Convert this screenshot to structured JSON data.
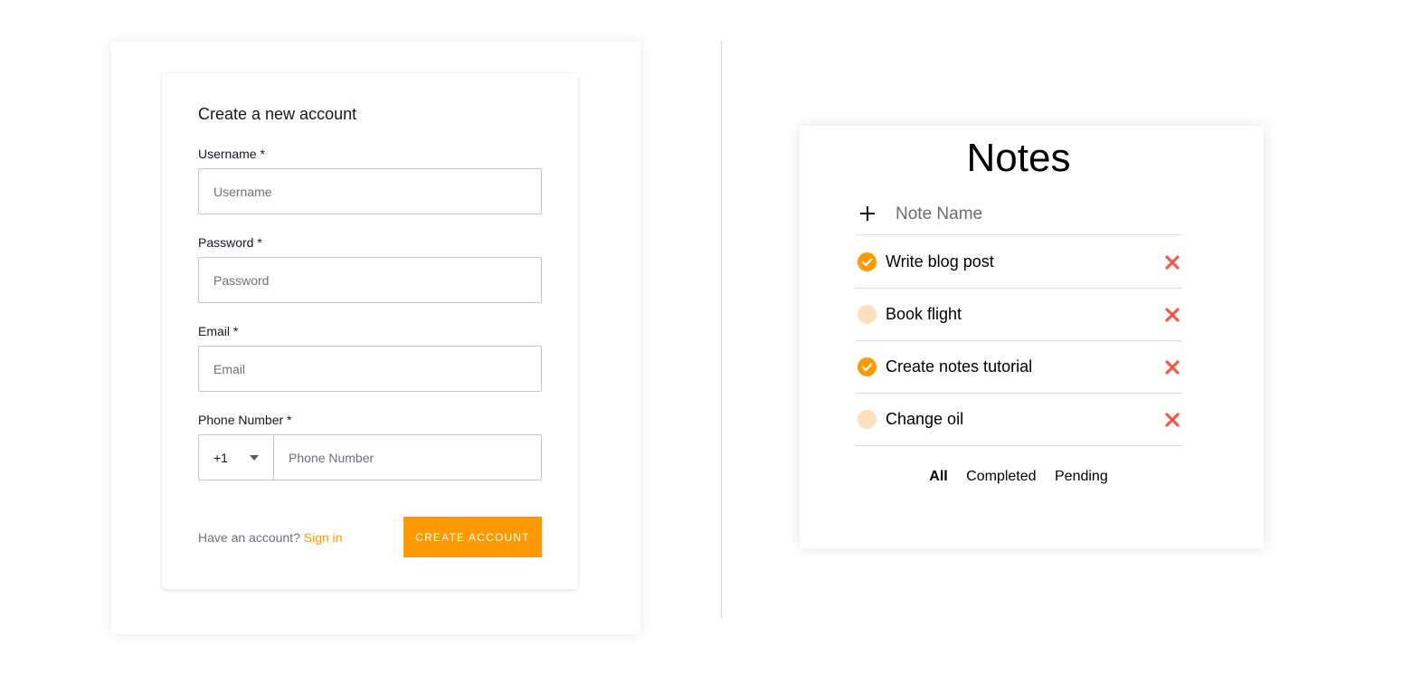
{
  "signup": {
    "title": "Create a new account",
    "username_label": "Username *",
    "username_placeholder": "Username",
    "password_label": "Password *",
    "password_placeholder": "Password",
    "email_label": "Email *",
    "email_placeholder": "Email",
    "phone_label": "Phone Number *",
    "dial_code": "+1",
    "phone_placeholder": "Phone Number",
    "have_account_text": "Have an account?",
    "signin_link": "Sign in",
    "create_button": "CREATE ACCOUNT"
  },
  "notes": {
    "title": "Notes",
    "add_placeholder": "Note Name",
    "items": [
      {
        "text": "Write blog post",
        "completed": true
      },
      {
        "text": "Book flight",
        "completed": false
      },
      {
        "text": "Create notes tutorial",
        "completed": true
      },
      {
        "text": "Change oil",
        "completed": false
      }
    ],
    "filters": {
      "all": "All",
      "completed": "Completed",
      "pending": "Pending",
      "active": "all"
    }
  },
  "colors": {
    "accent": "#ff9900",
    "pending_circle": "#fde0bd",
    "delete": "#f25a4a"
  },
  "icons": {
    "add": "plus-icon",
    "done": "checkmark-icon",
    "delete": "close-icon",
    "dropdown": "caret-down-icon"
  }
}
